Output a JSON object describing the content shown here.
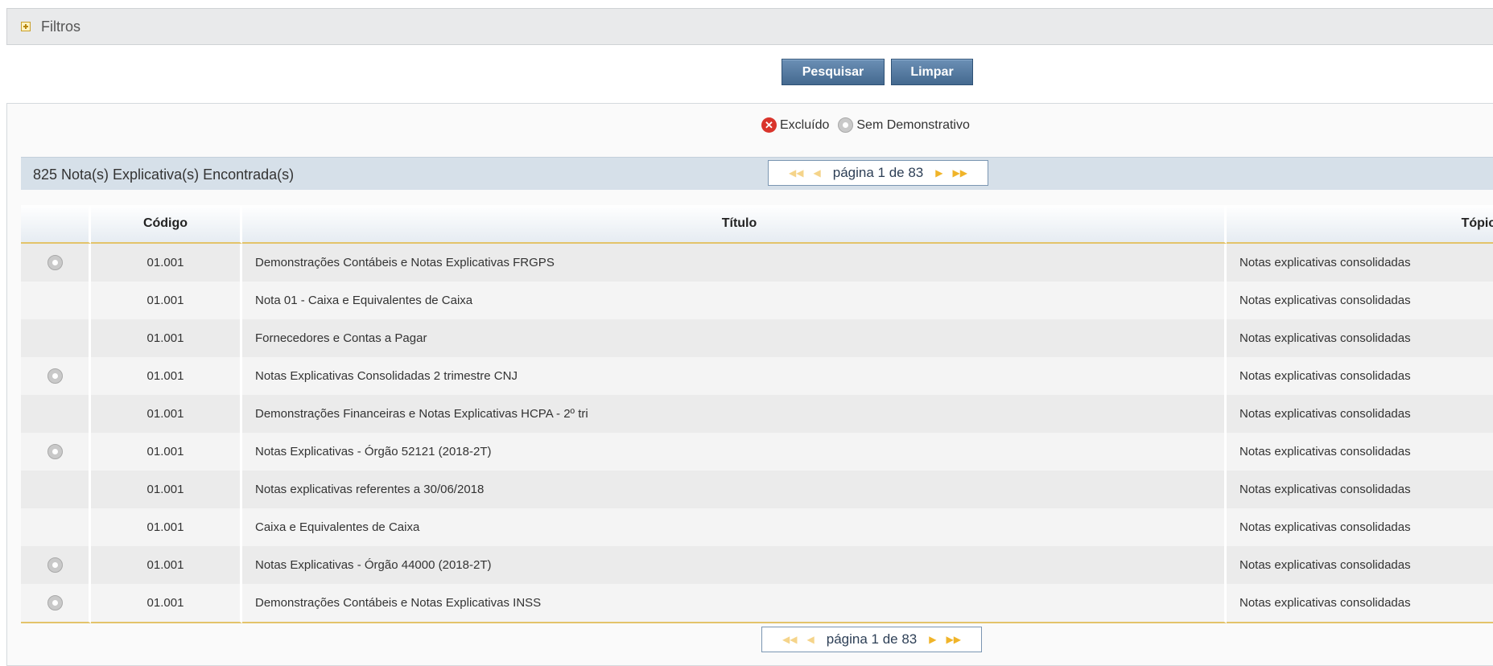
{
  "filters": {
    "label": "Filtros",
    "icon": "plus-box-icon"
  },
  "buttons": {
    "search": "Pesquisar",
    "clear": "Limpar"
  },
  "legend": {
    "excluded": "Excluído",
    "no_statement": "Sem Demonstrativo"
  },
  "results": {
    "count_text": "825 Nota(s) Explicativa(s) Encontrada(s)"
  },
  "pager": {
    "label": "página 1 de 83",
    "first_icon": "first-page-icon",
    "prev_icon": "prev-page-icon",
    "next_icon": "next-page-icon",
    "last_icon": "last-page-icon"
  },
  "table": {
    "headers": {
      "status": "",
      "code": "Código",
      "title": "Título",
      "topic": "Tópico"
    },
    "rows": [
      {
        "status": "sem-demonstrativo",
        "code": "01.001",
        "title": "Demonstrações Contábeis e Notas Explicativas FRGPS",
        "topic": "Notas explicativas consolidadas"
      },
      {
        "status": "",
        "code": "01.001",
        "title": "Nota 01 - Caixa e Equivalentes de Caixa",
        "topic": "Notas explicativas consolidadas"
      },
      {
        "status": "",
        "code": "01.001",
        "title": "Fornecedores e Contas a Pagar",
        "topic": "Notas explicativas consolidadas"
      },
      {
        "status": "sem-demonstrativo",
        "code": "01.001",
        "title": "Notas Explicativas Consolidadas 2 trimestre CNJ",
        "topic": "Notas explicativas consolidadas"
      },
      {
        "status": "",
        "code": "01.001",
        "title": "Demonstrações Financeiras e Notas Explicativas HCPA - 2º tri",
        "topic": "Notas explicativas consolidadas"
      },
      {
        "status": "sem-demonstrativo",
        "code": "01.001",
        "title": "Notas Explicativas - Órgão 52121 (2018-2T)",
        "topic": "Notas explicativas consolidadas"
      },
      {
        "status": "",
        "code": "01.001",
        "title": "Notas explicativas referentes a 30/06/2018",
        "topic": "Notas explicativas consolidadas"
      },
      {
        "status": "",
        "code": "01.001",
        "title": "Caixa e Equivalentes de Caixa",
        "topic": "Notas explicativas consolidadas"
      },
      {
        "status": "sem-demonstrativo",
        "code": "01.001",
        "title": "Notas Explicativas - Órgão 44000 (2018-2T)",
        "topic": "Notas explicativas consolidadas"
      },
      {
        "status": "sem-demonstrativo",
        "code": "01.001",
        "title": "Demonstrações Contábeis e Notas Explicativas INSS",
        "topic": "Notas explicativas consolidadas"
      }
    ]
  }
}
